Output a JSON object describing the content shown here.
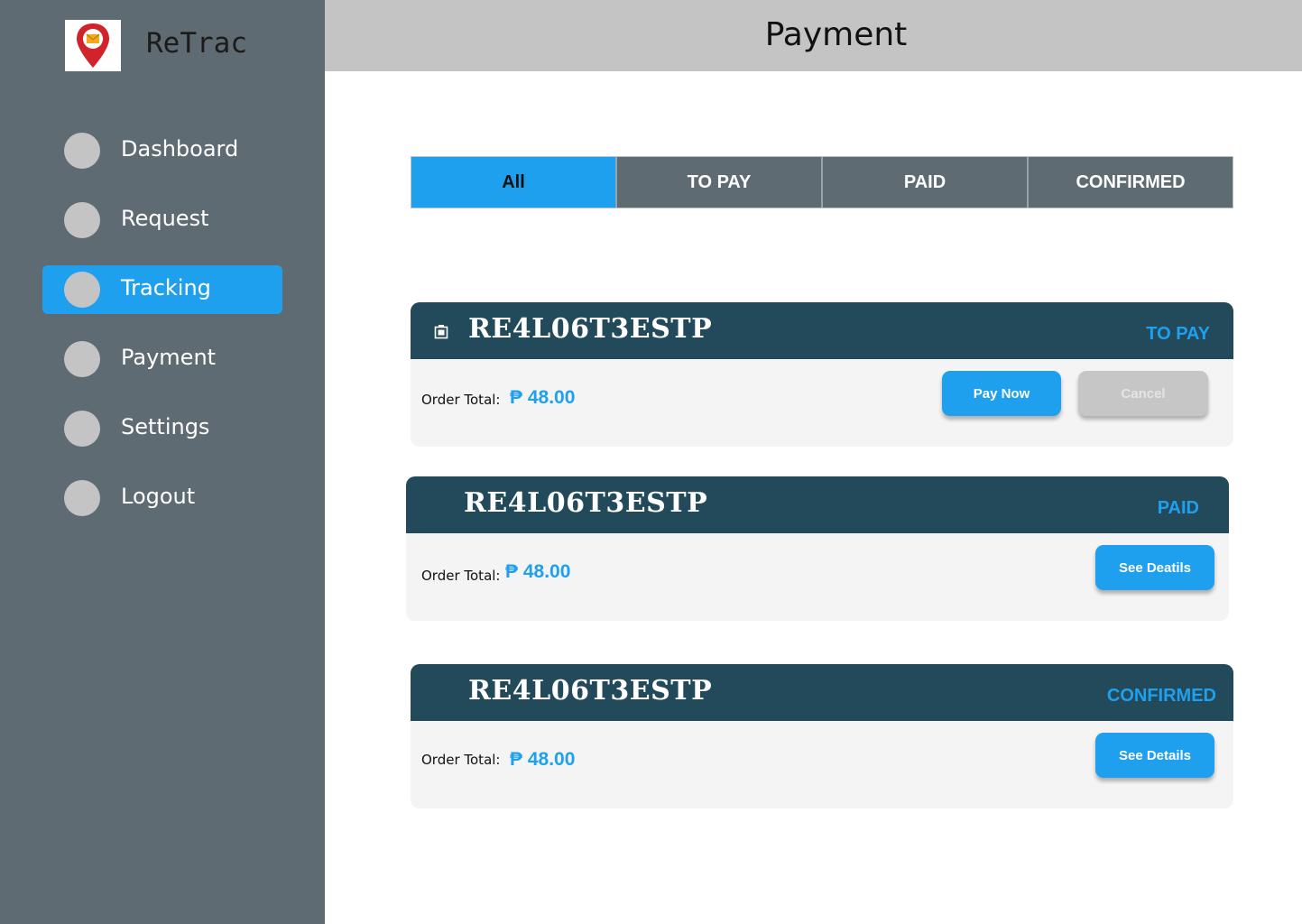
{
  "app": {
    "name": "ReTrac"
  },
  "colors": {
    "sidebar": "#5f6b72",
    "accent": "#1fa0ee",
    "card_header": "#234a5a",
    "header_bar": "#c4c4c4"
  },
  "sidebar": {
    "items": [
      {
        "label": "Dashboard",
        "active": false
      },
      {
        "label": "Request",
        "active": false
      },
      {
        "label": "Tracking",
        "active": true
      },
      {
        "label": "Payment",
        "active": false
      },
      {
        "label": "Settings",
        "active": false
      },
      {
        "label": "Logout",
        "active": false
      }
    ]
  },
  "header": {
    "title": "Payment"
  },
  "tabs": [
    {
      "label": "All",
      "active": true
    },
    {
      "label": "TO PAY",
      "active": false
    },
    {
      "label": "PAID",
      "active": false
    },
    {
      "label": "CONFIRMED",
      "active": false
    }
  ],
  "orders": [
    {
      "id": "RE4L06T3ESTP",
      "status": "TO PAY",
      "total_label": "Order Total:",
      "total_value": "₱ 48.00",
      "icon": "package-icon",
      "buttons": [
        "Pay Now",
        "Cancel"
      ]
    },
    {
      "id": "RE4L06T3ESTP",
      "status": "PAID",
      "total_label": "Order Total:",
      "total_value": "₱ 48.00",
      "buttons": [
        "See Deatils"
      ]
    },
    {
      "id": "RE4L06T3ESTP",
      "status": "CONFIRMED",
      "total_label": "Order Total:",
      "total_value": "₱ 48.00",
      "buttons": [
        "See Details"
      ]
    }
  ]
}
